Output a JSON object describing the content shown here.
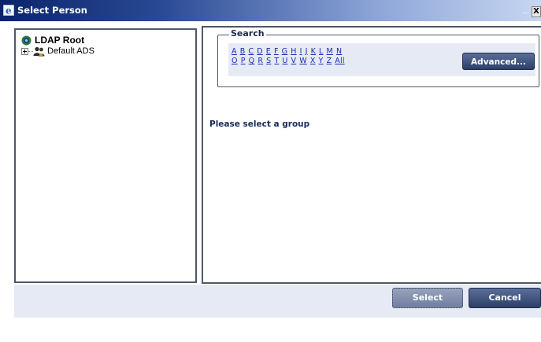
{
  "window": {
    "title": "Select Person",
    "title_dots": "...",
    "close_symbol": "X"
  },
  "tree": {
    "root_label": "LDAP Root",
    "children": [
      {
        "label": "Default ADS",
        "expander": "+"
      }
    ]
  },
  "search": {
    "legend": "Search",
    "letters_row1": [
      "A",
      "B",
      "C",
      "D",
      "E",
      "F",
      "G",
      "H",
      "I",
      "J",
      "K",
      "L",
      "M",
      "N"
    ],
    "letters_row2": [
      "O",
      "P",
      "Q",
      "R",
      "S",
      "T",
      "U",
      "V",
      "W",
      "X",
      "Y",
      "Z",
      "All"
    ],
    "advanced_label": "Advanced..."
  },
  "message": "Please select a group",
  "footer": {
    "select_label": "Select",
    "cancel_label": "Cancel"
  },
  "colors": {
    "title_bar_start": "#0a246a",
    "title_bar_end": "#c7d7f1",
    "panel_bg": "#e6eaf4",
    "button_dark": "#2c3f68",
    "link": "#1a2bb8"
  }
}
